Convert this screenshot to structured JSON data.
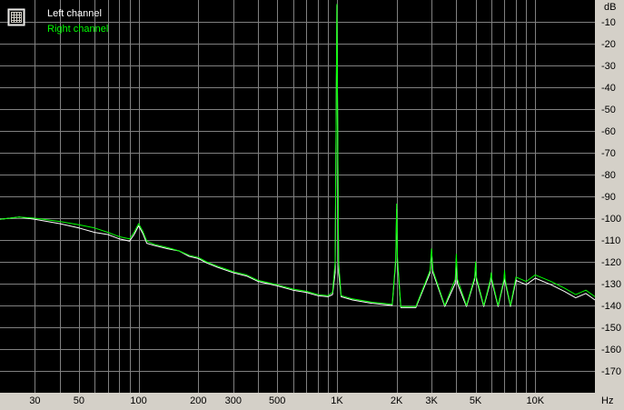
{
  "chart_data": {
    "type": "line",
    "title": "",
    "xscale": "log",
    "xlim": [
      20,
      20000
    ],
    "ylim": [
      -180,
      0
    ],
    "y_unit": "dB",
    "x_unit": "Hz",
    "grid": true,
    "legend_placement": "top-left",
    "x_ticks": [
      {
        "value": 30,
        "label": "30"
      },
      {
        "value": 50,
        "label": "50"
      },
      {
        "value": 100,
        "label": "100"
      },
      {
        "value": 200,
        "label": "200"
      },
      {
        "value": 300,
        "label": "300"
      },
      {
        "value": 500,
        "label": "500"
      },
      {
        "value": 1000,
        "label": "1K"
      },
      {
        "value": 2000,
        "label": "2K"
      },
      {
        "value": 3000,
        "label": "3K"
      },
      {
        "value": 5000,
        "label": "5K"
      },
      {
        "value": 10000,
        "label": "10K"
      }
    ],
    "y_ticks": [
      {
        "value": -10,
        "label": "-10"
      },
      {
        "value": -20,
        "label": "-20"
      },
      {
        "value": -30,
        "label": "-30"
      },
      {
        "value": -40,
        "label": "-40"
      },
      {
        "value": -50,
        "label": "-50"
      },
      {
        "value": -60,
        "label": "-60"
      },
      {
        "value": -70,
        "label": "-70"
      },
      {
        "value": -80,
        "label": "-80"
      },
      {
        "value": -90,
        "label": "-90"
      },
      {
        "value": -100,
        "label": "-100"
      },
      {
        "value": -110,
        "label": "-110"
      },
      {
        "value": -120,
        "label": "-120"
      },
      {
        "value": -130,
        "label": "-130"
      },
      {
        "value": -140,
        "label": "-140"
      },
      {
        "value": -150,
        "label": "-150"
      },
      {
        "value": -160,
        "label": "-160"
      },
      {
        "value": -170,
        "label": "-170"
      }
    ],
    "series": [
      {
        "name": "Left channel",
        "color": "#ffffff",
        "points": [
          [
            20,
            -100.5
          ],
          [
            25,
            -99.5
          ],
          [
            30,
            -100.5
          ],
          [
            40,
            -102.5
          ],
          [
            50,
            -104.5
          ],
          [
            60,
            -106.5
          ],
          [
            70,
            -107.5
          ],
          [
            80,
            -109.5
          ],
          [
            90,
            -110.5
          ],
          [
            95,
            -107.5
          ],
          [
            100,
            -103.5
          ],
          [
            105,
            -107
          ],
          [
            110,
            -111.5
          ],
          [
            120,
            -112.5
          ],
          [
            140,
            -114
          ],
          [
            160,
            -115
          ],
          [
            180,
            -117.5
          ],
          [
            200,
            -118.5
          ],
          [
            220,
            -120.5
          ],
          [
            250,
            -122.5
          ],
          [
            300,
            -125
          ],
          [
            350,
            -126.5
          ],
          [
            400,
            -129
          ],
          [
            500,
            -131
          ],
          [
            600,
            -133
          ],
          [
            700,
            -134
          ],
          [
            800,
            -135.5
          ],
          [
            900,
            -136
          ],
          [
            950,
            -135
          ],
          [
            980,
            -125
          ],
          [
            1000,
            -2.5
          ],
          [
            1020,
            -125
          ],
          [
            1050,
            -136
          ],
          [
            1200,
            -137.5
          ],
          [
            1500,
            -139
          ],
          [
            1900,
            -140
          ],
          [
            1980,
            -120
          ],
          [
            2000,
            -96
          ],
          [
            2020,
            -120
          ],
          [
            2100,
            -141
          ],
          [
            2500,
            -141
          ],
          [
            2950,
            -125
          ],
          [
            3000,
            -115.5
          ],
          [
            3050,
            -125
          ],
          [
            3500,
            -140.5
          ],
          [
            3950,
            -130
          ],
          [
            4000,
            -118.5
          ],
          [
            4050,
            -130
          ],
          [
            4500,
            -140.5
          ],
          [
            4950,
            -128
          ],
          [
            5000,
            -121.5
          ],
          [
            5050,
            -128
          ],
          [
            5500,
            -140.5
          ],
          [
            5950,
            -129
          ],
          [
            6000,
            -126.5
          ],
          [
            6050,
            -129
          ],
          [
            6500,
            -140.5
          ],
          [
            6950,
            -129
          ],
          [
            7000,
            -125.5
          ],
          [
            7050,
            -129
          ],
          [
            7500,
            -140.5
          ],
          [
            8000,
            -128.5
          ],
          [
            9000,
            -130.5
          ],
          [
            10000,
            -127.5
          ],
          [
            12000,
            -130.5
          ],
          [
            14000,
            -133.5
          ],
          [
            16000,
            -136.5
          ],
          [
            18000,
            -134.5
          ],
          [
            20000,
            -137.5
          ]
        ]
      },
      {
        "name": "Right channel",
        "color": "#00ff00",
        "points": [
          [
            20,
            -100.5
          ],
          [
            25,
            -99.5
          ],
          [
            30,
            -100
          ],
          [
            40,
            -101.5
          ],
          [
            50,
            -103
          ],
          [
            60,
            -104.5
          ],
          [
            70,
            -106.5
          ],
          [
            80,
            -108.5
          ],
          [
            90,
            -109.5
          ],
          [
            95,
            -106.5
          ],
          [
            100,
            -102.5
          ],
          [
            105,
            -106
          ],
          [
            110,
            -110.5
          ],
          [
            120,
            -112
          ],
          [
            140,
            -113.5
          ],
          [
            160,
            -115
          ],
          [
            180,
            -117
          ],
          [
            200,
            -118
          ],
          [
            220,
            -120
          ],
          [
            250,
            -122
          ],
          [
            300,
            -124.5
          ],
          [
            350,
            -126
          ],
          [
            400,
            -128.5
          ],
          [
            500,
            -130.5
          ],
          [
            600,
            -132.5
          ],
          [
            700,
            -133.5
          ],
          [
            800,
            -135
          ],
          [
            900,
            -135.5
          ],
          [
            950,
            -134
          ],
          [
            980,
            -120
          ],
          [
            1000,
            -2
          ],
          [
            1020,
            -120
          ],
          [
            1050,
            -135.5
          ],
          [
            1200,
            -137
          ],
          [
            1500,
            -138.5
          ],
          [
            1900,
            -139.5
          ],
          [
            1980,
            -118
          ],
          [
            2000,
            -93.5
          ],
          [
            2020,
            -118
          ],
          [
            2100,
            -140.5
          ],
          [
            2500,
            -140.5
          ],
          [
            2950,
            -124
          ],
          [
            3000,
            -114
          ],
          [
            3050,
            -124
          ],
          [
            3500,
            -140
          ],
          [
            3950,
            -128
          ],
          [
            4000,
            -116.5
          ],
          [
            4050,
            -128
          ],
          [
            4500,
            -140
          ],
          [
            4950,
            -127
          ],
          [
            5000,
            -120
          ],
          [
            5050,
            -127
          ],
          [
            5500,
            -140
          ],
          [
            5950,
            -128
          ],
          [
            6000,
            -125
          ],
          [
            6050,
            -128
          ],
          [
            6500,
            -140
          ],
          [
            6950,
            -128
          ],
          [
            7000,
            -124
          ],
          [
            7050,
            -128
          ],
          [
            7500,
            -140
          ],
          [
            8000,
            -127
          ],
          [
            9000,
            -129
          ],
          [
            10000,
            -126
          ],
          [
            12000,
            -129
          ],
          [
            14000,
            -132
          ],
          [
            16000,
            -135
          ],
          [
            18000,
            -133
          ],
          [
            20000,
            -136
          ]
        ]
      }
    ]
  },
  "legend": {
    "items": [
      {
        "name": "Left channel",
        "color": "#ffffff"
      },
      {
        "name": "Right channel",
        "color": "#00ff00"
      }
    ]
  },
  "icons": {
    "legend_toggle": "grid-icon"
  },
  "colors": {
    "plot_bg": "#000000",
    "grid": "#808080",
    "frame": "#d4d0c8"
  }
}
